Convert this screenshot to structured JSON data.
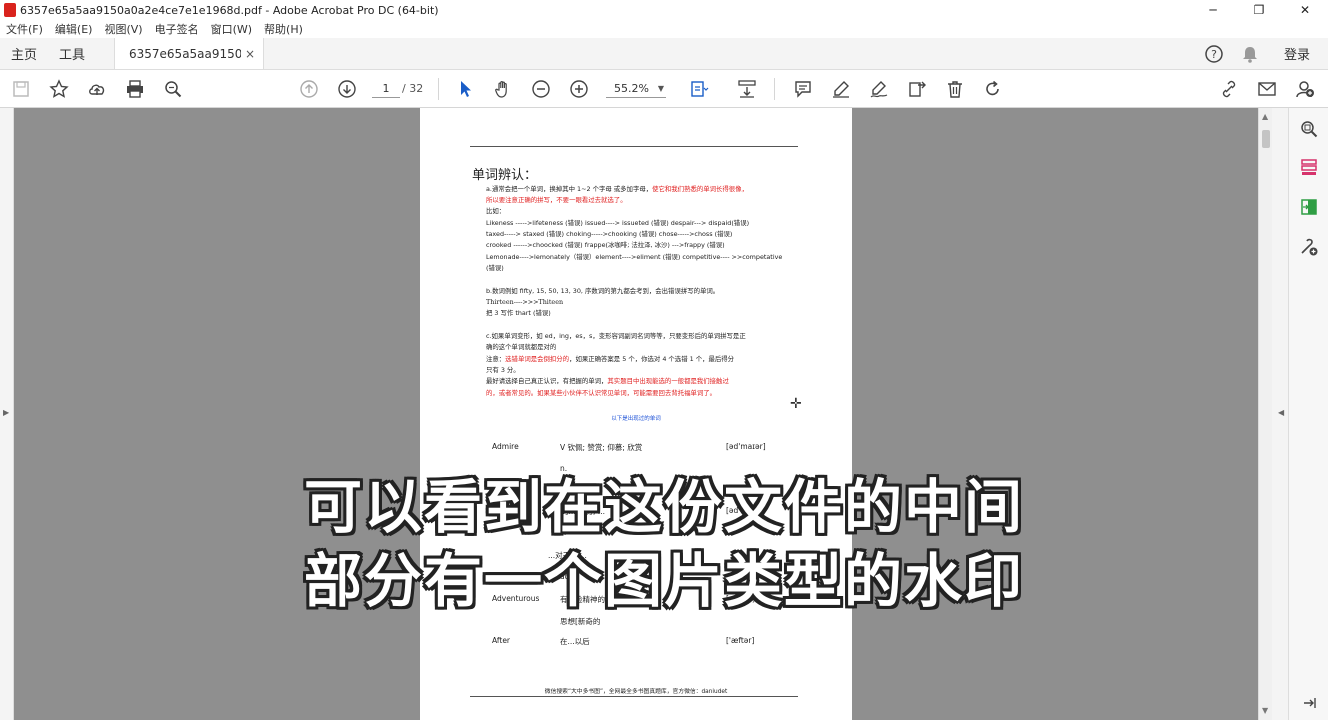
{
  "window": {
    "title": "6357e65a5aa9150a0a2e4ce7e1e1968d.pdf - Adobe Acrobat Pro DC (64-bit)",
    "minimize": "─",
    "maximize": "❐",
    "close": "✕"
  },
  "menu": [
    "文件(F)",
    "编辑(E)",
    "视图(V)",
    "电子签名",
    "窗口(W)",
    "帮助(H)"
  ],
  "tabs": {
    "home": "主页",
    "tools": "工具",
    "document": "6357e65a5aa9150a...",
    "close": "×",
    "login": "登录"
  },
  "toolbar": {
    "page_current": "1",
    "page_total": "/ 32",
    "zoom": "55.2%"
  },
  "document": {
    "heading": "单词辨认：",
    "para_a": [
      {
        "text": "a.通常会把一个单词，换掉其中 1~2 个字母   或多加字母，",
        "red": "使它和我们熟悉的单词长得很像，"
      },
      {
        "text": "",
        "red": "所以要注意正确的拼写，不要一眼看过去就选了。"
      },
      {
        "text": "比如：",
        "red": ""
      },
      {
        "text": "Likeness ----->lifeteness (错误)    issued----> issueted (错误)      despair---> dispaid(错误)",
        "red": ""
      },
      {
        "text": "taxed-----> staxed (错误)        choking----->chooking (错误)      chose----->choss (错误)",
        "red": ""
      },
      {
        "text": "crooked ------>choocked (错误)     frappe(冰咖啡; 法拉泽, 冰沙) --->frappy (错误)",
        "red": ""
      },
      {
        "text": "Lemonade---->lemonately（错误）element---->eliment (错误)  competitive---- >>competative",
        "red": ""
      },
      {
        "text": "(错误)",
        "red": ""
      }
    ],
    "para_b": [
      "b.数词例如      fifty, 15, 50, 13, 30, 序数词的第九都会考到，会出错误拼写的单词。",
      "Thirteen---->>>Thiteen",
      "把 3 写作 thart (错误)"
    ],
    "para_c": [
      {
        "text": "c.如果单词变形，如      ed，ing，es，s，变形容词副词名词等等，只要变形后的单词拼写是正",
        "red": ""
      },
      {
        "text": "确的这个单词就都是对的",
        "red": ""
      },
      {
        "text": "注意：",
        "red": "选错单词是会倒扣分的",
        "tail": "，如果正确答案是 5 个，你选对 4 个选错 1 个，最后得分"
      },
      {
        "text": "只有 3 分。",
        "red": ""
      },
      {
        "text": "最好请选择自己真正认识，有把握的单词，",
        "red": "其实题目中出现能选的一般都是我们接触过"
      },
      {
        "text": "",
        "red": "的，或者常见的。如果某些小伙伴不认识常见单词，可能需要回去背托福单词了。"
      }
    ],
    "center_note": "以下是出现过的单词",
    "words": [
      {
        "word": "Admire",
        "pos": "V 钦佩; 赞赏; 仰慕; 欣赏",
        "ipa": "[əd'maɪər]"
      },
      {
        "word": "",
        "pos": "n.",
        "ipa": ""
      },
      {
        "word": "",
        "pos": "(...)的... 优势, ...",
        "ipa": "[əd'...ɪdʒ]"
      },
      {
        "word": "",
        "pos": "v.",
        "ipa": ""
      },
      {
        "word": "",
        "pos": "...对于... ...",
        "ipa": ""
      },
      {
        "word": "",
        "pos": "adj.",
        "ipa": ""
      },
      {
        "word": "Adventurous",
        "pos": "有冒险精神的... ...的, 方...",
        "ipa": "[...ventʃ...]"
      },
      {
        "word": "",
        "pos": "思想[新奇的",
        "ipa": ""
      },
      {
        "word": "After",
        "pos": "在...以后",
        "ipa": "['æftər]"
      }
    ],
    "footer": "微信搜索“大中多书图”，全网最全多书图真题库，官方微信：daniudet"
  },
  "subtitle": {
    "line1": "可以看到在这份文件的中间",
    "line2": "部分有一个图片类型的水印"
  }
}
